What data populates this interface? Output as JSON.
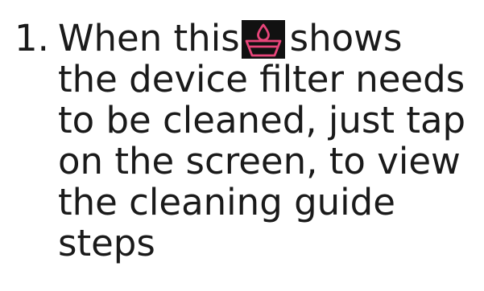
{
  "step": {
    "number": "1.",
    "line1_before": "When this",
    "line1_after": "shows",
    "lines": [
      "the device filter needs",
      "to be cleaned, just tap",
      "on the screen, to view",
      "the cleaning guide",
      "steps"
    ],
    "icon": "filter-clean-icon",
    "icon_color": "#e8457a",
    "icon_bg": "#111111"
  }
}
